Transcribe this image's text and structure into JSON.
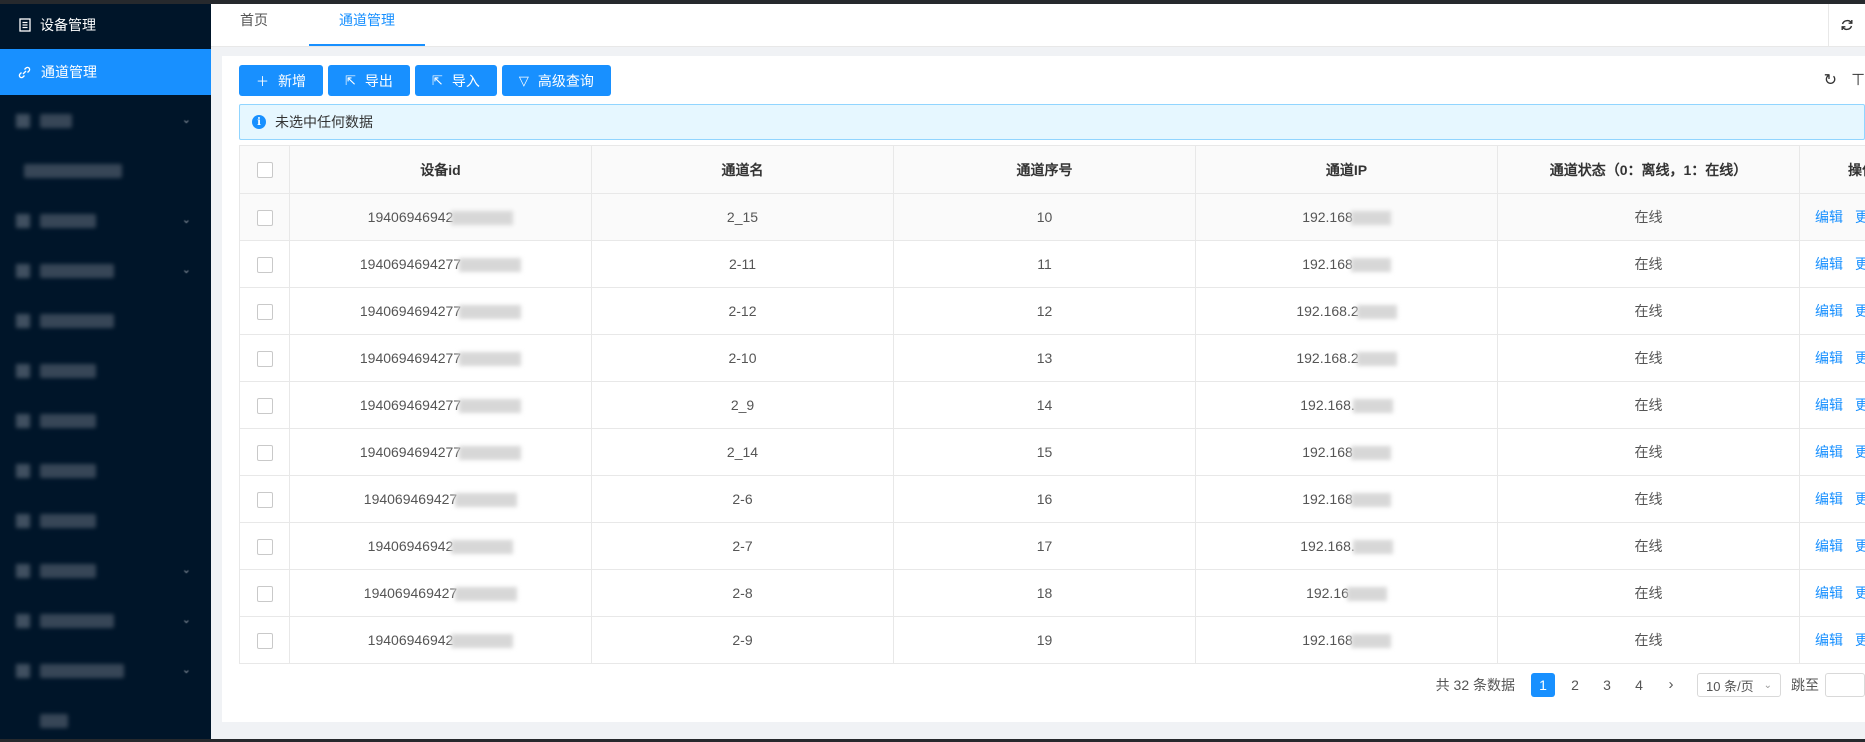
{
  "sidebar": {
    "header": "设备管理",
    "active_item": "通道管理"
  },
  "tabs": [
    {
      "label": "首页"
    },
    {
      "label": "通道管理"
    }
  ],
  "toolbar": {
    "add": "新增",
    "export": "导出",
    "import": "导入",
    "query": "高级查询"
  },
  "alert": {
    "text": "未选中任何数据"
  },
  "table": {
    "headers": [
      "设备id",
      "通道名",
      "通道序号",
      "通道IP",
      "通道状态（0：离线，1：在线）",
      "操作"
    ],
    "rows": [
      {
        "device_id": "19406946942",
        "name": "2_15",
        "seq": "10",
        "ip": "192.168",
        "status": "在线"
      },
      {
        "device_id": "1940694694277",
        "name": "2-11",
        "seq": "11",
        "ip": "192.168",
        "status": "在线"
      },
      {
        "device_id": "1940694694277",
        "name": "2-12",
        "seq": "12",
        "ip": "192.168.2",
        "status": "在线"
      },
      {
        "device_id": "1940694694277",
        "name": "2-10",
        "seq": "13",
        "ip": "192.168.2",
        "status": "在线"
      },
      {
        "device_id": "1940694694277",
        "name": "2_9",
        "seq": "14",
        "ip": "192.168.",
        "status": "在线"
      },
      {
        "device_id": "1940694694277",
        "name": "2_14",
        "seq": "15",
        "ip": "192.168",
        "status": "在线"
      },
      {
        "device_id": "194069469427",
        "name": "2-6",
        "seq": "16",
        "ip": "192.168",
        "status": "在线"
      },
      {
        "device_id": "19406946942",
        "name": "2-7",
        "seq": "17",
        "ip": "192.168.",
        "status": "在线"
      },
      {
        "device_id": "194069469427",
        "name": "2-8",
        "seq": "18",
        "ip": "192.16",
        "status": "在线"
      },
      {
        "device_id": "19406946942",
        "name": "2-9",
        "seq": "19",
        "ip": "192.168",
        "status": "在线"
      }
    ],
    "edit_label": "编辑",
    "more_label": "更多"
  },
  "pagination": {
    "total": "共 32 条数据",
    "pages": [
      "1",
      "2",
      "3",
      "4"
    ],
    "current": "1",
    "page_size": "10 条/页",
    "jump_label": "跳至"
  }
}
